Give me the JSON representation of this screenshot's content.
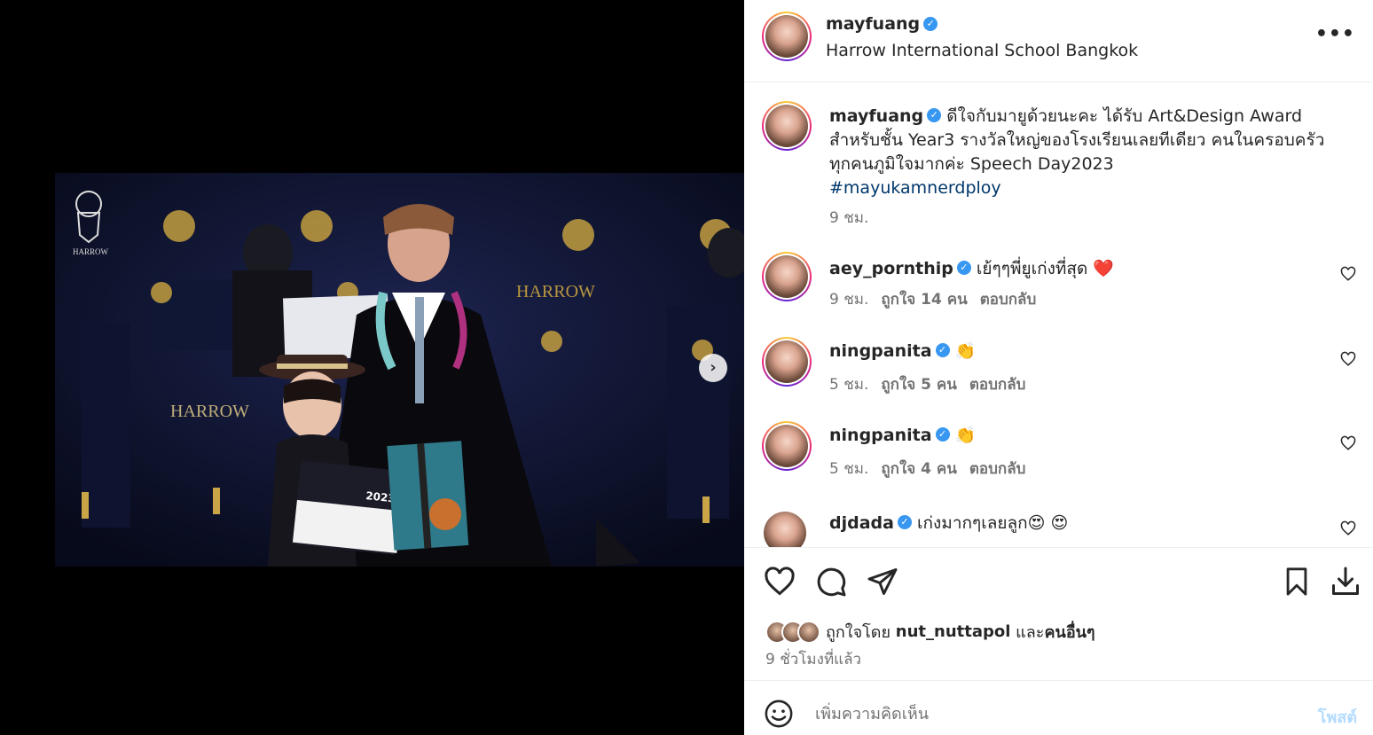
{
  "header": {
    "username": "mayfuang",
    "location": "Harrow International School Bangkok",
    "more_label": "•••"
  },
  "caption": {
    "username": "mayfuang",
    "text": "ดีใจกับมายูด้วยนะคะ ได้รับ Art&Design Award สำหรับชั้น Year3 รางวัลใหญ่ของโรงเรียนเลยทีเดียว คนในครอบครัวทุกคนภูมิใจมากค่ะ Speech Day2023",
    "hashtag": "#mayukamnerdploy",
    "time": "9 ชม."
  },
  "comments": [
    {
      "username": "aey_pornthip",
      "text": "เย้ๆๆพี่ยูเก่งที่สุด ❤️",
      "time": "9 ชม.",
      "likes": "ถูกใจ 14 คน",
      "reply": "ตอบกลับ"
    },
    {
      "username": "ningpanita",
      "text": "👏",
      "time": "5 ชม.",
      "likes": "ถูกใจ 5 คน",
      "reply": "ตอบกลับ"
    },
    {
      "username": "ningpanita",
      "text": "👏",
      "time": "5 ชม.",
      "likes": "ถูกใจ 4 คน",
      "reply": "ตอบกลับ"
    },
    {
      "username": "djdada",
      "text": "เก่งมากๆเลยลูก😍 😍",
      "time": "",
      "likes": "",
      "reply": ""
    }
  ],
  "likes_line": {
    "prefix": "ถูกใจโดย",
    "user": "nut_nuttapol",
    "middle": "และ",
    "others": "คนอื่นๆ"
  },
  "posted_time": "9 ชั่วโมงที่แล้ว",
  "add_comment": {
    "placeholder": "เพิ่มความคิดเห็น",
    "post_label": "โพสต์"
  },
  "photo": {
    "certificate_year": "2023",
    "banner_text": "HARROW",
    "crest_text": "HARROW"
  },
  "colors": {
    "verified": "#3897f0",
    "hashtag": "#00376b",
    "post_button": "#b3dbff",
    "heart": "#ed4956"
  }
}
